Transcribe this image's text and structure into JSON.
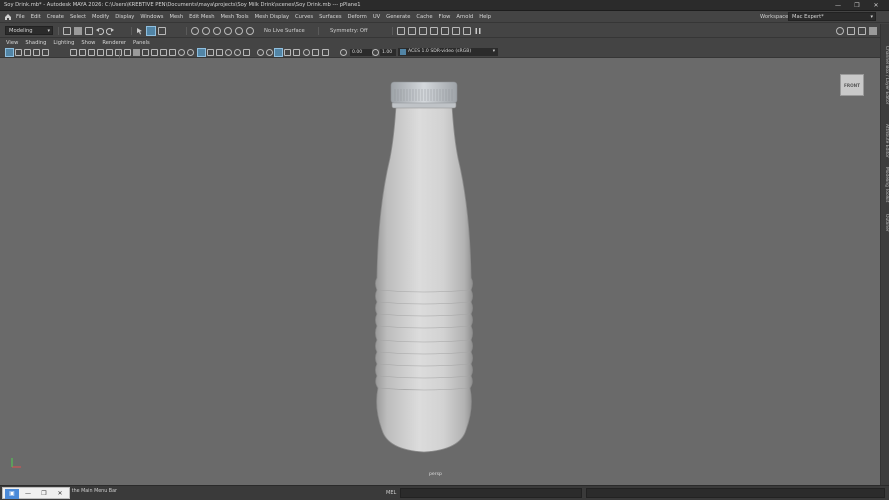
{
  "window": {
    "title": "Soy Drink.mb* - Autodesk MAYA 2026: C:\\Users\\KREBTIVE PEN\\Documents\\maya\\projects\\Soy Milk Drink\\scenes\\Soy Drink.mb  ---  pPlane1",
    "controls": [
      "—",
      "❐",
      "✕"
    ]
  },
  "menubar": {
    "items": [
      "File",
      "Edit",
      "Create",
      "Select",
      "Modify",
      "Display",
      "Windows",
      "Mesh",
      "Edit Mesh",
      "Mesh Tools",
      "Mesh Display",
      "Curves",
      "Surfaces",
      "Deform",
      "UV",
      "Generate",
      "Cache",
      "Flow",
      "Arnold",
      "Help"
    ],
    "workspace_label": "Workspace :",
    "workspace_value": "Mac Expert*"
  },
  "statusline": {
    "mode": "Modeling",
    "live_surface": "No Live Surface",
    "symmetry": "Symmetry: Off"
  },
  "viewport_menu": {
    "items": [
      "View",
      "Shading",
      "Lighting",
      "Show",
      "Renderer",
      "Panels"
    ]
  },
  "viewport_toolbar": {
    "exposure": "0.00",
    "gamma": "1.00",
    "color_space": "ACES 1.0 SDR-video (sRGB)"
  },
  "viewport": {
    "view_cube": "FRONT",
    "camera": "persp",
    "axis_labels": {
      "x": "x",
      "y": "y"
    }
  },
  "right_tabs": [
    "Channel Box / Layer Editor",
    "Attribute Editor",
    "Modeling Toolkit",
    "Outliner"
  ],
  "bottombar": {
    "help_text": "el in the Main Menu Bar",
    "mel_label": "MEL"
  },
  "colors": {
    "viewport_bg": "#6a6a6a",
    "bottle": "#dcdcdc",
    "cap": "#c8ccd0",
    "ui_bg": "#444444",
    "accent": "#5285a6"
  }
}
